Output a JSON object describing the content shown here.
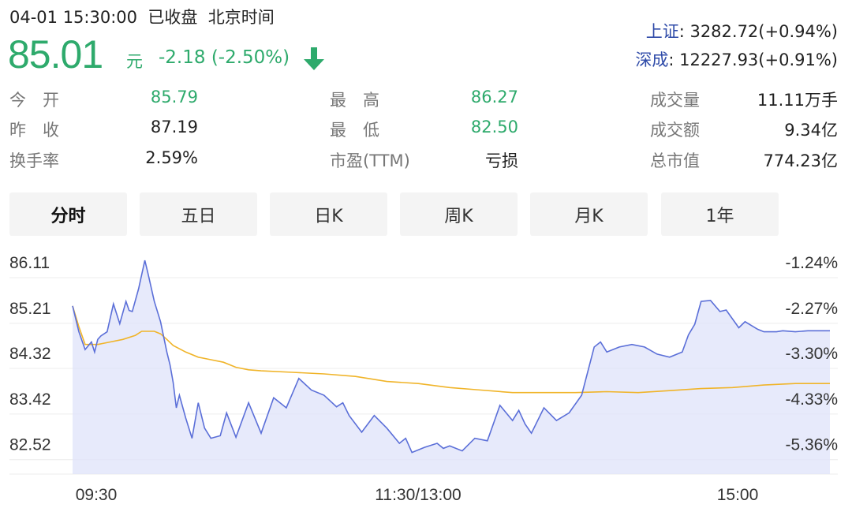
{
  "header": {
    "datetime": "04-01 15:30:00",
    "status": "已收盘",
    "timezone": "北京时间",
    "price": "85.01",
    "unit": "元",
    "change": "-2.18 (-2.50%)",
    "trend_icon": "down-arrow-icon",
    "colors": {
      "down": "#2eaa6c",
      "up": "#e03b3b",
      "index_name": "#2e4aa8"
    }
  },
  "indices": [
    {
      "name": "上证",
      "value": ": 3282.72(+0.94%)"
    },
    {
      "name": "深成",
      "value": ": 12227.93(+0.91%)"
    }
  ],
  "stats": {
    "open_label": "今　开",
    "open": "85.79",
    "prev_close_label": "昨　收",
    "prev_close": "87.19",
    "turnover_label": "换手率",
    "turnover": "2.59%",
    "high_label": "最　高",
    "high": "86.27",
    "low_label": "最　低",
    "low": "82.50",
    "pe_label": "市盈(TTM)",
    "pe": "亏损",
    "volume_label": "成交量",
    "volume": "11.11万手",
    "amount_label": "成交额",
    "amount": "9.34亿",
    "mcap_label": "总市值",
    "mcap": "774.23亿"
  },
  "tabs": [
    "分时",
    "五日",
    "日K",
    "周K",
    "月K",
    "1年"
  ],
  "active_tab": 0,
  "chart_data": {
    "type": "line",
    "y_ticks": [
      "86.11",
      "85.21",
      "84.32",
      "83.42",
      "82.52"
    ],
    "y_tick_values": [
      86.11,
      85.21,
      84.32,
      83.42,
      82.52
    ],
    "pct_ticks": [
      "-1.24%",
      "-2.27%",
      "-3.30%",
      "-4.33%",
      "-5.36%"
    ],
    "x_labels": [
      "09:30",
      "11:30/13:00",
      "15:00"
    ],
    "ylim": [
      82.22,
      86.11
    ],
    "xlim": [
      0,
      241
    ],
    "grid": true,
    "series": [
      {
        "color": "#5b6fd8",
        "fill": "#dfe3fa",
        "x": [
          0,
          2,
          4,
          6,
          7,
          8,
          9,
          11,
          13,
          15,
          17,
          18,
          19,
          21,
          23,
          24,
          26,
          28,
          30,
          31,
          32,
          33,
          34,
          36,
          38,
          40,
          42,
          44,
          47,
          49,
          52,
          56,
          60,
          64,
          68,
          72,
          76,
          80,
          84,
          86,
          88,
          92,
          96,
          100,
          104,
          106,
          108,
          112,
          116,
          118,
          120,
          124,
          128,
          132,
          136,
          140,
          142,
          144,
          146,
          150,
          154,
          158,
          162,
          166,
          168,
          170,
          174,
          178,
          182,
          186,
          190,
          194,
          196,
          198,
          200,
          203,
          206,
          208,
          212,
          214,
          218,
          220,
          224,
          226,
          230,
          234,
          241
        ],
        "y": [
          85.21,
          84.7,
          84.35,
          84.5,
          84.3,
          84.55,
          84.62,
          84.7,
          85.25,
          84.86,
          85.3,
          85.12,
          85.1,
          85.55,
          86.11,
          85.85,
          85.3,
          84.9,
          84.3,
          84.05,
          83.7,
          83.2,
          83.45,
          83.0,
          82.6,
          83.3,
          82.8,
          82.6,
          82.65,
          83.1,
          82.62,
          83.3,
          82.7,
          83.4,
          83.2,
          83.78,
          83.55,
          83.45,
          83.22,
          83.3,
          83.05,
          82.72,
          83.05,
          82.8,
          82.5,
          82.6,
          82.32,
          82.42,
          82.5,
          82.4,
          82.45,
          82.35,
          82.6,
          82.55,
          83.25,
          82.95,
          83.15,
          82.88,
          82.7,
          83.2,
          82.95,
          83.1,
          83.45,
          84.4,
          84.5,
          84.3,
          84.4,
          84.45,
          84.4,
          84.26,
          84.2,
          84.3,
          84.64,
          84.85,
          85.3,
          85.32,
          85.1,
          85.13,
          84.78,
          84.9,
          84.75,
          84.7,
          84.7,
          84.72,
          84.7,
          84.72,
          84.72
        ]
      },
      {
        "color": "#f0b429",
        "x": [
          0,
          2,
          4,
          8,
          12,
          16,
          20,
          22,
          26,
          28,
          30,
          32,
          36,
          40,
          44,
          48,
          52,
          56,
          60,
          70,
          80,
          90,
          100,
          110,
          120,
          130,
          140,
          150,
          160,
          170,
          180,
          190,
          200,
          210,
          220,
          230,
          241
        ],
        "y": [
          85.21,
          84.8,
          84.45,
          84.45,
          84.5,
          84.55,
          84.63,
          84.71,
          84.71,
          84.66,
          84.55,
          84.43,
          84.3,
          84.2,
          84.15,
          84.1,
          84.0,
          83.95,
          83.93,
          83.9,
          83.87,
          83.82,
          83.72,
          83.68,
          83.6,
          83.55,
          83.5,
          83.5,
          83.5,
          83.52,
          83.5,
          83.54,
          83.58,
          83.6,
          83.65,
          83.68,
          83.68
        ]
      }
    ]
  }
}
